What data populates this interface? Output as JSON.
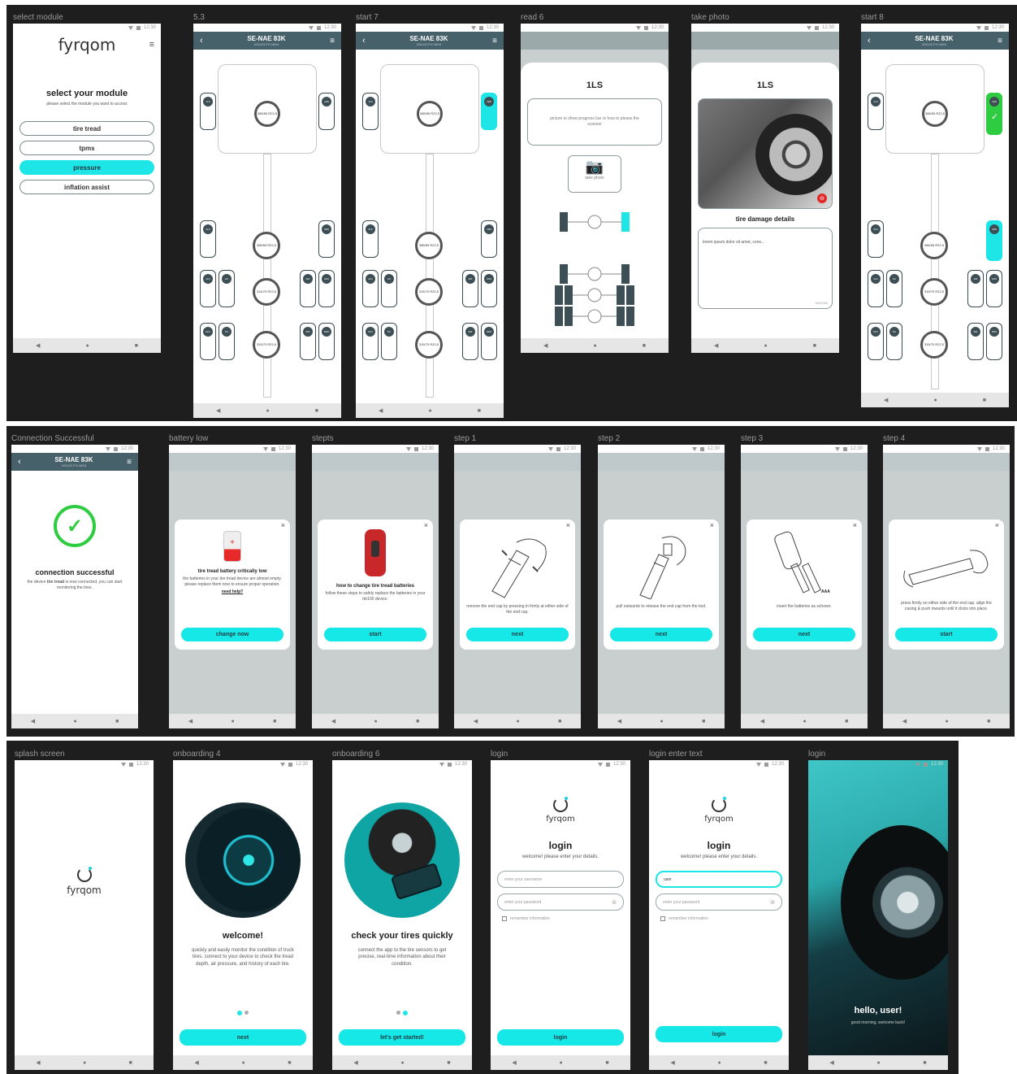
{
  "status_time": "12:30",
  "rows": {
    "row1": {
      "frames": [
        {
          "label": "select module"
        },
        {
          "label": "5.3"
        },
        {
          "label": "start 7"
        },
        {
          "label": "read 6"
        },
        {
          "label": "take  photo"
        },
        {
          "label": "start 8"
        }
      ]
    },
    "row2": {
      "frames": [
        {
          "label": "Connection Successful"
        },
        {
          "label": "battery low"
        },
        {
          "label": "stepts"
        },
        {
          "label": "step 1"
        },
        {
          "label": "step 2"
        },
        {
          "label": "step 3"
        },
        {
          "label": "step 4"
        }
      ]
    },
    "row3": {
      "frames": [
        {
          "label": "splash screen"
        },
        {
          "label": "onboarding 4"
        },
        {
          "label": "onboarding 6"
        },
        {
          "label": "login"
        },
        {
          "label": "login enter text"
        },
        {
          "label": "login"
        }
      ]
    }
  },
  "brand": {
    "name": "fyrqom",
    "accent": "#1ee6e6",
    "dark": "#47616a",
    "success": "#2ecc40"
  },
  "vehicle": {
    "plate": "SE-NAE 83K",
    "model": "VOLVO FH 16X4"
  },
  "module_screen": {
    "title": "select your module",
    "subtitle": "please select the module you want to access",
    "modules": [
      "tire tread",
      "tpms",
      "pressure",
      "inflation assist"
    ]
  },
  "tires": {
    "front_left": "1LS",
    "front_right": "1RS",
    "mid_left": "3LS",
    "mid_right": "3RS",
    "row4": [
      "4LO",
      "4LI",
      "4RI",
      "4RO"
    ],
    "row5": [
      "5LO",
      "5LI",
      "5RI",
      "5RO"
    ],
    "sizes": [
      "385/55 R22,5",
      "385/55 R22,5",
      "315/70 R22,5",
      "315/70 R22,5"
    ]
  },
  "read_screen": {
    "title": "1LS",
    "hint": "picture to show progress bar or how to please the scanner",
    "take_photo": "take photo"
  },
  "photo_screen": {
    "title": "1LS",
    "details_title": "tire damage details",
    "details_text": "lorem ipsum dolor sit amet, cons...",
    "counter": "35/2.000"
  },
  "connection": {
    "title": "connection successful",
    "text_a": "the device",
    "text_bold": "tire tread",
    "text_b": "is now connected, you can start monitoring the tires."
  },
  "battery": {
    "title": "tire tread battery critically low",
    "text": "the batteries in your tire tread device are almost empty. please replace them now to ensure proper operation.",
    "help": "need help?",
    "button": "change now"
  },
  "steps": {
    "title": "how to change tire tread batteries",
    "text": "follow these steps to safely replace the batteries in your tdr100 device.",
    "button": "start"
  },
  "step1": {
    "text": "remove the end cap by pressing in firmly at either side of the end cap.",
    "button": "next"
  },
  "step2": {
    "text": "pull outwards to release the end cap from the tool.",
    "button": "next"
  },
  "step3": {
    "text": "insert the batteries as schown.",
    "label": "AAA",
    "button": "next"
  },
  "step4": {
    "text": "press firmly on either side of the end cap, align the casing & push inwards until it clicks into place.",
    "button": "start"
  },
  "onboarding4": {
    "title": "welcome!",
    "text": "quickly and easily monitor the condition of truck tires. connect to your device to check the tread depth, air pressure, and history of each tire.",
    "button": "next"
  },
  "onboarding6": {
    "title": "check your tires quickly",
    "text": "connect the app to the tire sensors to get precise, real-time information about their condition.",
    "button": "let's get started!"
  },
  "login": {
    "title": "login",
    "subtitle": "welcome! please enter your details.",
    "username_placeholder": "enter your username",
    "password_placeholder": "enter your password",
    "remember": "remember information",
    "button": "login",
    "typed_user": "user"
  },
  "hello": {
    "title": "hello, user!",
    "subtitle": "good morning, welcome back!"
  }
}
